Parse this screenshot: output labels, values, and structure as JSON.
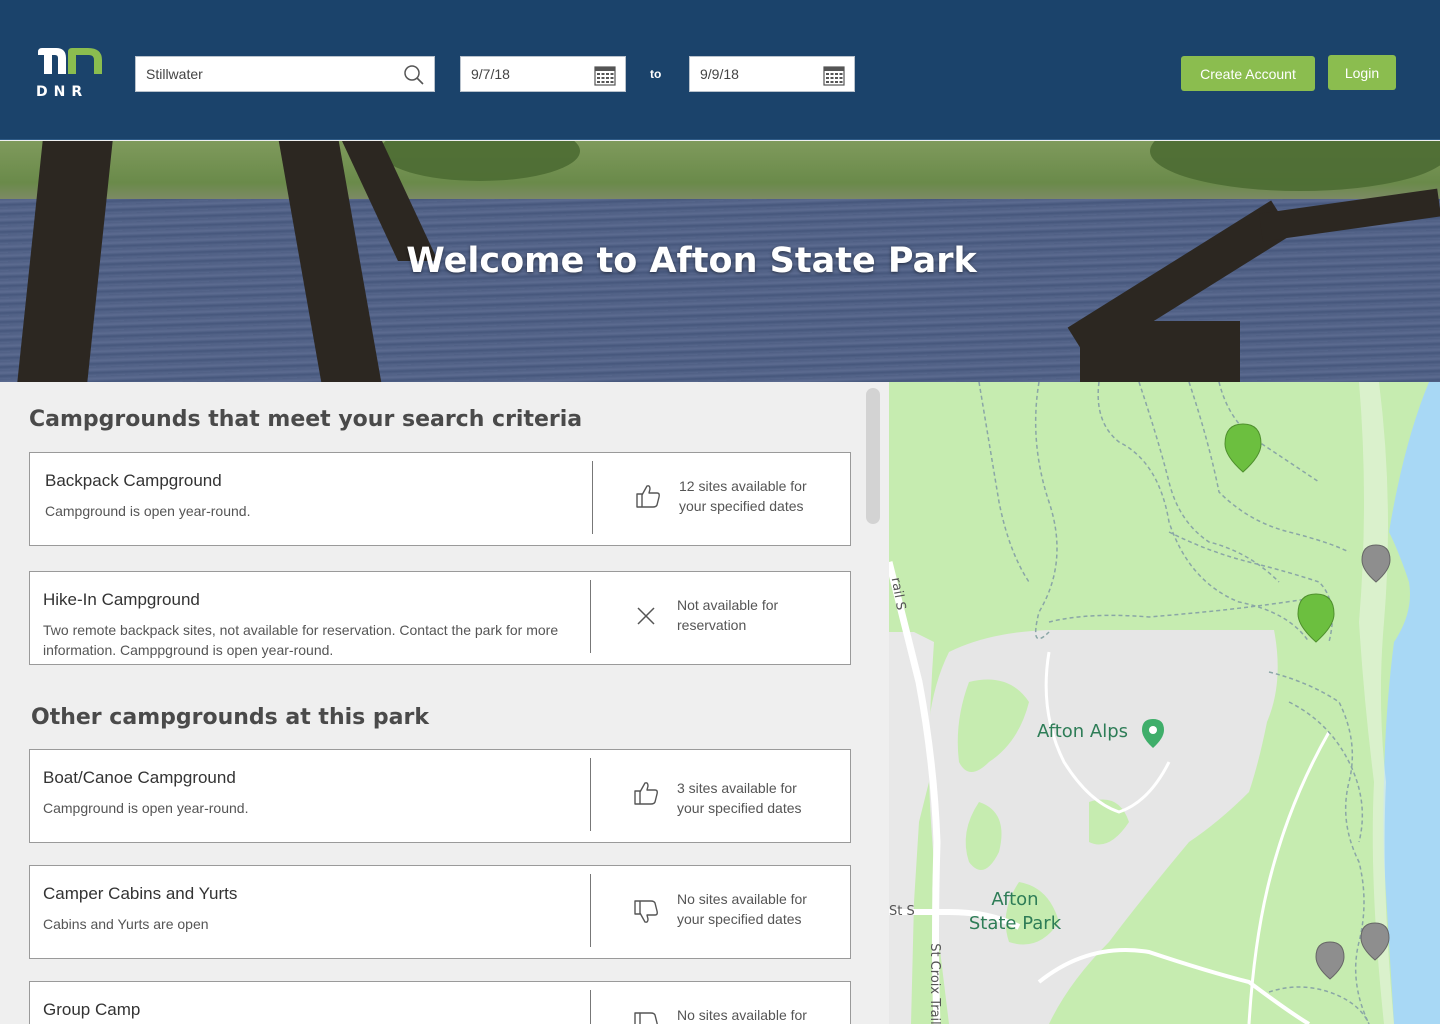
{
  "header": {
    "logo_text": "DNR",
    "search": {
      "value": "Stillwater"
    },
    "date_from": {
      "value": "9/7/18"
    },
    "to_label": "to",
    "date_to": {
      "value": "9/9/18"
    },
    "create_account_label": "Create Account",
    "login_label": "Login"
  },
  "hero": {
    "title": "Welcome to Afton State Park"
  },
  "results": {
    "heading": "Campgrounds that meet your search criteria",
    "items": [
      {
        "name": "Backpack Campground",
        "description": "Campground is open year-round.",
        "status": "12 sites available for your specified dates",
        "status_icon": "thumbs-up-icon"
      },
      {
        "name": "Hike-In Campground",
        "description": "Two remote backpack sites, not available for reservation. Contact the park for more information. Camppground is open year-round.",
        "status": "Not available for reservation",
        "status_icon": "close-icon"
      }
    ]
  },
  "other": {
    "heading": "Other campgrounds at this park",
    "items": [
      {
        "name": "Boat/Canoe Campground",
        "description": "Campground is open year-round.",
        "status": "3 sites available for your specified dates",
        "status_icon": "thumbs-up-icon"
      },
      {
        "name": "Camper Cabins and Yurts",
        "description": "Cabins and Yurts are open",
        "status": "No sites available for your specified dates",
        "status_icon": "thumbs-down-icon"
      },
      {
        "name": "Group Camp",
        "description": "",
        "status": "No sites available for",
        "status_icon": "thumbs-down-icon"
      }
    ]
  },
  "map": {
    "labels": {
      "afton_alps": "Afton Alps",
      "park": "Afton State Park",
      "trail_s": "rail S",
      "st_s": "St S",
      "st_croix": "St Croix Trail"
    },
    "pins": [
      {
        "state": "available"
      },
      {
        "state": "unavailable"
      },
      {
        "state": "available"
      },
      {
        "state": "unavailable"
      },
      {
        "state": "unavailable"
      }
    ]
  },
  "colors": {
    "header_bg": "#1b436b",
    "accent_green": "#8bbd4f",
    "map_green": "#c6ecb0",
    "pin_available": "#6cbf3f",
    "pin_unavailable": "#8e8e8e",
    "water": "#a8d8f5"
  }
}
